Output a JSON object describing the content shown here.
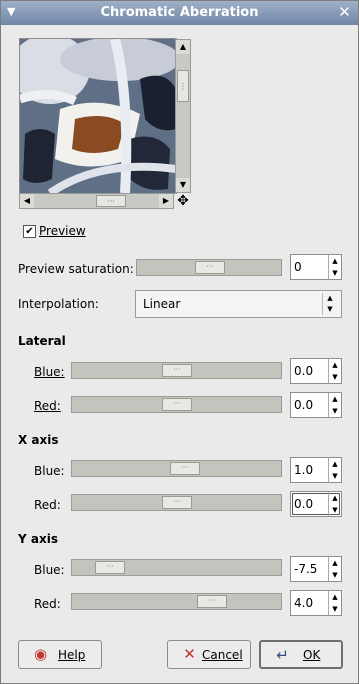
{
  "window": {
    "title": "Chromatic Aberration"
  },
  "preview": {
    "label": "Preview",
    "checked": true
  },
  "preview_saturation": {
    "label": "Preview saturation:",
    "value": "0"
  },
  "interpolation": {
    "label": "Interpolation:",
    "value": "Linear"
  },
  "lateral": {
    "heading": "Lateral",
    "blue": {
      "label": "Blue:",
      "value": "0.0"
    },
    "red": {
      "label": "Red:",
      "value": "0.0"
    }
  },
  "x_axis": {
    "heading": "X  axis",
    "blue": {
      "label": "Blue:",
      "value": "1.0"
    },
    "red": {
      "label": "Red:",
      "value": "0.0"
    }
  },
  "y_axis": {
    "heading": "Y  axis",
    "blue": {
      "label": "Blue:",
      "value": "-7.5"
    },
    "red": {
      "label": "Red:",
      "value": "4.0"
    }
  },
  "buttons": {
    "help": "Help",
    "cancel": "Cancel",
    "ok": "OK"
  },
  "icons": {
    "close": "close-icon",
    "move": "move-icon",
    "help": "help-icon",
    "cancel": "cancel-icon",
    "ok": "ok-icon"
  }
}
